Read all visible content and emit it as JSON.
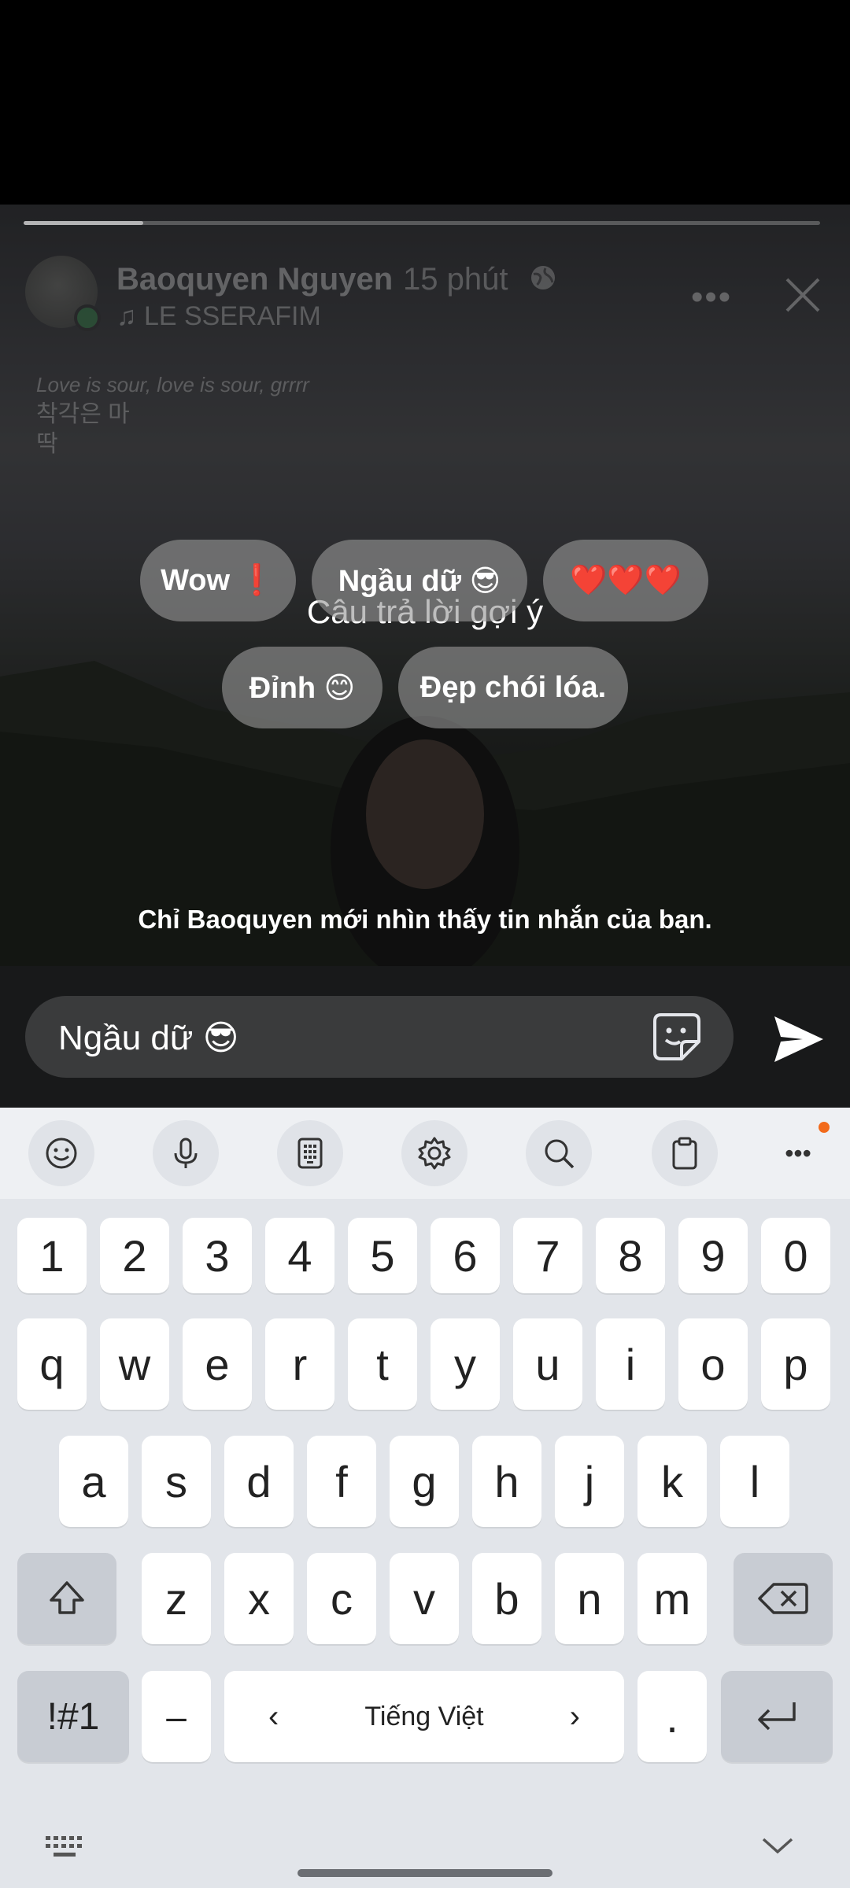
{
  "story": {
    "progress": 0.15,
    "author": "Baoquyen Nguyen",
    "time": "15 phút",
    "music": "LE SSERAFIM",
    "lyrics": [
      "Love is sour, love is sour, grrrr",
      "착각은 마",
      "딱"
    ]
  },
  "suggestions": {
    "title": "Câu trả lời gợi ý",
    "chips": [
      "Wow ❗",
      "Ngầu dữ 😎",
      "❤️❤️❤️",
      "Đỉnh 😊",
      "Đẹp chói lóa."
    ]
  },
  "privacy_note": "Chỉ Baoquyen mới nhìn thấy tin nhắn của bạn.",
  "composer": {
    "text": "Ngầu dữ 😎"
  },
  "keyboard": {
    "toolbar_icons": [
      "emoji-icon",
      "microphone-icon",
      "keypad-icon",
      "settings-icon",
      "search-icon",
      "clipboard-icon",
      "more-icon"
    ],
    "row_numbers": [
      "1",
      "2",
      "3",
      "4",
      "5",
      "6",
      "7",
      "8",
      "9",
      "0"
    ],
    "row1": [
      "q",
      "w",
      "e",
      "r",
      "t",
      "y",
      "u",
      "i",
      "o",
      "p"
    ],
    "row2": [
      "a",
      "s",
      "d",
      "f",
      "g",
      "h",
      "j",
      "k",
      "l"
    ],
    "row3": [
      "z",
      "x",
      "c",
      "v",
      "b",
      "n",
      "m"
    ],
    "symbols_label": "!#1",
    "dash_label": "–",
    "space_label": "Tiếng Việt",
    "period_label": ".",
    "accent_color": "#f26a1b"
  }
}
